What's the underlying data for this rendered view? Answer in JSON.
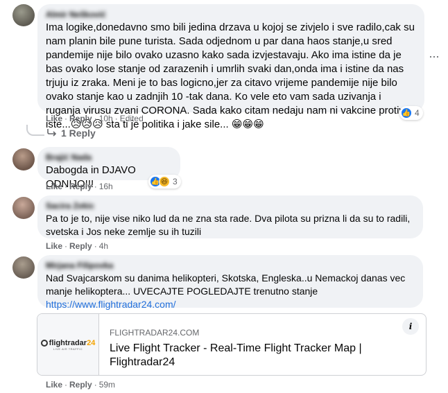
{
  "comments": [
    {
      "author": "Almir Nešković",
      "text": "Ima logike,donedavno smo bili jedina drzava u kojoj se zivjelo i sve radilo,cak su nam planin bile pune turista. Sada odjednom u par dana haos stanje,u sred pandemije nije bilo ovako uzasno kako sada izvjestavaju. Ako ima istine da je bas ovako lose stanje od zarazenih i umrlih svaki dan,onda ima i istine da nas trjuju iz zraka. Meni je to bas logicno,jer za citavo vrijeme pandemije nije bilo ovako stanje kao u zadnjih 10 -tak dana. Ko vele eto vam sada uzivanja i ruganja virusu zvani CORONA. Sada kako citam nedaju nam ni vakcine protiv iste...😥😥😥 sta ti je politika i jake sile... 😁😁😁",
      "like": "Like",
      "reply": "Reply",
      "time": "10h",
      "edited": "Edited",
      "reaction_count": "4",
      "replies_label": "1 Reply"
    },
    {
      "author": "Brajić Nada",
      "text": "Dabogda in DJAVO ODNIJO!!!",
      "like": "Like",
      "reply": "Reply",
      "time": "16h",
      "reaction_count": "3"
    },
    {
      "author": "Sacira Zekic",
      "text": "Pa to je to, nije vise niko lud da ne zna sta rade. Dva pilota su prizna li da su to radili, svetska i Jos neke zemlje su ih tuzili",
      "like": "Like",
      "reply": "Reply",
      "time": "4h"
    },
    {
      "author": "Mirjana Filipovka",
      "text": "Nad Svajcarskom su danima helikopteri, Skotska, Engleska..u Nemackoj danas vec manje helikoptera... UVECAJTE POGLEDAJTE trenutno stanje",
      "link": "https://www.flightradar24.com/",
      "like": "Like",
      "reply": "Reply",
      "time": "59m",
      "preview": {
        "domain": "FLIGHTRADAR24.COM",
        "title": "Live Flight Tracker - Real-Time Flight Tracker Map | Flightradar24",
        "logo_text": "flightradar",
        "logo_num": "24",
        "logo_sub": "LIVE AIR TRAFFIC",
        "info": "i"
      }
    }
  ],
  "more_label": "···",
  "colors": {
    "link": "#216fdb",
    "like_reaction": "#1877f2",
    "haha_reaction": "#f7b928",
    "bubble": "#f0f2f5"
  },
  "icons": [
    "like-reaction-icon",
    "haha-reaction-icon",
    "reply-arrow-icon",
    "more-options-icon",
    "info-icon"
  ]
}
